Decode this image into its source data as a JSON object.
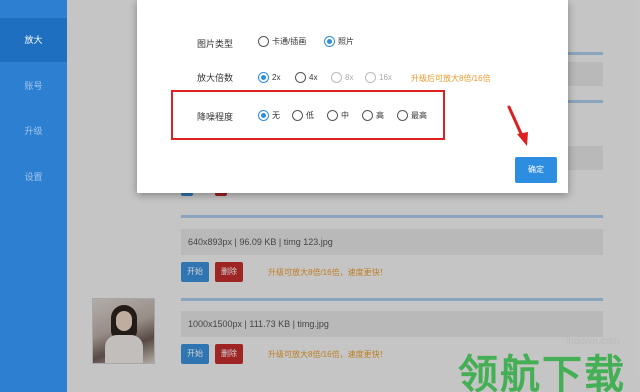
{
  "sidebar": {
    "items": [
      {
        "label": "放大",
        "active": true
      },
      {
        "label": "账号",
        "active": false
      },
      {
        "label": "升级",
        "active": false
      },
      {
        "label": "设置",
        "active": false
      }
    ]
  },
  "list": {
    "items": [
      {
        "info": "640x893px | 96.09 KB | timg 123.jpg",
        "start_label": "开始",
        "delete_label": "删除",
        "upgrade_msg": "升级可放大8倍/16倍，速度更快！"
      },
      {
        "info": "1000x1500px | 111.73 KB | timg.jpg",
        "start_label": "开始",
        "delete_label": "删除",
        "upgrade_msg": "升级可放大8倍/16倍，速度更快！"
      }
    ]
  },
  "dialog": {
    "image_type": {
      "label": "图片类型",
      "options": [
        {
          "label": "卡通/插画",
          "checked": false
        },
        {
          "label": "照片",
          "checked": true
        }
      ]
    },
    "scale": {
      "label": "放大倍数",
      "options": [
        {
          "label": "2x",
          "checked": true,
          "disabled": false
        },
        {
          "label": "4x",
          "checked": false,
          "disabled": false
        },
        {
          "label": "8x",
          "checked": false,
          "disabled": true
        },
        {
          "label": "16x",
          "checked": false,
          "disabled": true
        }
      ],
      "note": "升级后可放大8倍/16倍"
    },
    "denoise": {
      "label": "降噪程度",
      "options": [
        {
          "label": "无",
          "checked": true
        },
        {
          "label": "低",
          "checked": false
        },
        {
          "label": "中",
          "checked": false
        },
        {
          "label": "高",
          "checked": false
        },
        {
          "label": "最高",
          "checked": false
        }
      ]
    },
    "confirm_label": "确定"
  },
  "watermark": {
    "url": "lhdown.com",
    "text": "领航下载"
  },
  "colors": {
    "accent": "#2d8de0",
    "sidebar": "#2d7fd1",
    "delete": "#c22c2c",
    "note": "#e8992a",
    "highlight": "#e02020"
  }
}
